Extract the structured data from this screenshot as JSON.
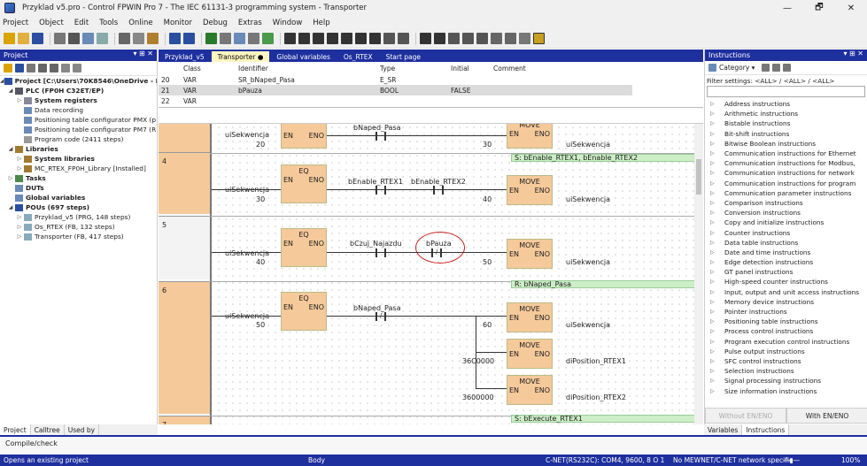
{
  "window": {
    "title": "Przyklad v5.pro - Control FPWIN Pro 7 - The IEC 61131-3 programming system - Transporter",
    "min": "—",
    "max": "🗗",
    "close": "✕"
  },
  "menu": [
    "Project",
    "Object",
    "Edit",
    "Tools",
    "Online",
    "Monitor",
    "Debug",
    "Extras",
    "Window",
    "Help"
  ],
  "project_panel": {
    "title": "Project",
    "pin": "▾ ⊞ ✕",
    "tree": [
      {
        "label": "Project [C:\\Users\\70K8546\\OneDrive - Panas",
        "level": 0,
        "bold": true,
        "arrow": "◢"
      },
      {
        "label": "PLC (FP0H C32ET/EP)",
        "level": 1,
        "bold": true,
        "arrow": "◢"
      },
      {
        "label": "System registers",
        "level": 2,
        "bold": true,
        "arrow": "▷"
      },
      {
        "label": "Data recording",
        "level": 2,
        "bold": false,
        "arrow": ""
      },
      {
        "label": "Positioning table configurator PMX (p",
        "level": 2,
        "bold": false,
        "arrow": ""
      },
      {
        "label": "Positioning table configurator PM7 (R",
        "level": 2,
        "bold": false,
        "arrow": ""
      },
      {
        "label": "Program code (2411 steps)",
        "level": 2,
        "bold": false,
        "arrow": ""
      },
      {
        "label": "Libraries",
        "level": 1,
        "bold": true,
        "arrow": "◢"
      },
      {
        "label": "System libraries",
        "level": 2,
        "bold": true,
        "arrow": "▷"
      },
      {
        "label": "MC_RTEX_FP0H_Library [Installed]",
        "level": 2,
        "bold": false,
        "arrow": "▷"
      },
      {
        "label": "Tasks",
        "level": 1,
        "bold": true,
        "arrow": "▷"
      },
      {
        "label": "DUTs",
        "level": 1,
        "bold": true,
        "arrow": ""
      },
      {
        "label": "Global variables",
        "level": 1,
        "bold": true,
        "arrow": ""
      },
      {
        "label": "POUs (697 steps)",
        "level": 1,
        "bold": true,
        "arrow": "◢"
      },
      {
        "label": "Przyklad_v5 (PRG, 148 steps)",
        "level": 2,
        "bold": false,
        "arrow": "▷"
      },
      {
        "label": "Os_RTEX (FB, 132 steps)",
        "level": 2,
        "bold": false,
        "arrow": "▷"
      },
      {
        "label": "Transporter (FB, 417 steps)",
        "level": 2,
        "bold": false,
        "arrow": "▷"
      }
    ],
    "tabs": [
      "Project",
      "Calltree",
      "Used by"
    ]
  },
  "editor_tabs": [
    "Przyklad_v5",
    "Transporter ●",
    "Global variables",
    "Os_RTEX",
    "Start page"
  ],
  "declarations": {
    "headers": [
      "Class",
      "Identifier",
      "Type",
      "Initial",
      "Comment"
    ],
    "rows": [
      [
        "20",
        "VAR",
        "SR_bNaped_Pasa",
        "E_SR",
        ""
      ],
      [
        "21",
        "VAR",
        "bPauza",
        "BOOL",
        "FALSE"
      ],
      [
        "22",
        "VAR",
        "",
        "",
        ""
      ]
    ]
  },
  "networks": [
    {
      "num": "",
      "var": "uiSekwencja",
      "cmp": "20",
      "contact1": "bNaped_Pasa",
      "move_val": "30",
      "out": "uiSekwencja",
      "coil": "S: bEnable_RTEX1, bEnable_RTEX2"
    },
    {
      "num": "4",
      "var": "uiSekwencja",
      "cmp": "30",
      "contact1": "bEnable_RTEX1",
      "contact2": "bEnable_RTEX2",
      "move_val": "40",
      "out": "uiSekwencja"
    },
    {
      "num": "5",
      "var": "uiSekwencja",
      "cmp": "40",
      "contact1": "bCzuj_Najazdu",
      "contact2": "bPauza",
      "move_val": "50",
      "out": "uiSekwencja",
      "coil": "R: bNaped_Pasa"
    },
    {
      "num": "6",
      "var": "uiSekwencja",
      "cmp": "50",
      "contact1": "bNaped_Pasa",
      "move_val": "60",
      "out": "uiSekwencja",
      "move2_val": "36C0000",
      "out2": "diPosition_RTEX1",
      "move3_val": "3600000",
      "out3": "diPosition_RTEX2",
      "coil": "S: bExecute_RTEX1"
    },
    {
      "num": "7"
    }
  ],
  "fb_labels": {
    "eq": "EQ",
    "move": "MOVE",
    "en": "EN",
    "eno": "ENO",
    "neg": "/"
  },
  "instructions_panel": {
    "title": "Instructions",
    "category": "Category ▾",
    "filter": "Filter settings: <ALL> / <ALL> / <ALL>",
    "items": [
      "Address instructions",
      "Arithmetic instructions",
      "Bistable instructions",
      "Bit-shift instructions",
      "Bitwise Boolean instructions",
      "Communication instructions for Ethernet",
      "Communication instructions for Modbus,",
      "Communication instructions for network",
      "Communication instructions for program",
      "Communication parameter instructions",
      "Comparison instructions",
      "Conversion instructions",
      "Copy and initialize instructions",
      "Counter instructions",
      "Data table instructions",
      "Date and time instructions",
      "Edge detection instructions",
      "GT panel instructions",
      "High-speed counter instructions",
      "Input, output and unit access instructions",
      "Memory device instructions",
      "Pointer instructions",
      "Positioning table instructions",
      "Process control instructions",
      "Program execution control instructions",
      "Pulse output instructions",
      "SFC control instructions",
      "Selection instructions",
      "Signal processing instructions",
      "Size information instructions"
    ],
    "btn_without": "Without EN/ENO",
    "btn_with": "With EN/ENO",
    "tabs": [
      "Variables",
      "Instructions"
    ]
  },
  "output": {
    "text": "Compile/check"
  },
  "status": {
    "left": "Opens an existing project",
    "mid": "Body",
    "conn": "C-NET(RS232C): COM4, 9600, 8 O 1",
    "net": "No MEWNET/C-NET network specifie",
    "zoom": "100%"
  },
  "colors": {
    "accent": "#1e2f9e",
    "fb": "#f5c99a",
    "coil": "#cdeec7",
    "highlight": "#c22"
  }
}
